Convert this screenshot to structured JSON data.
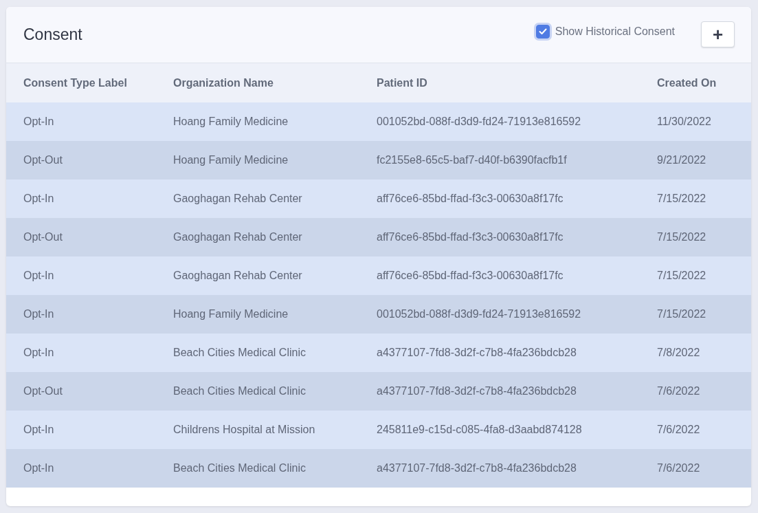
{
  "card": {
    "title": "Consent"
  },
  "show_historical": {
    "label": "Show Historical Consent",
    "checked": true
  },
  "add_button": {
    "label": "+"
  },
  "table": {
    "columns": [
      "Consent Type Label",
      "Organization Name",
      "Patient ID",
      "Created On"
    ],
    "rows": [
      [
        "Opt-In",
        "Hoang Family Medicine",
        "001052bd-088f-d3d9-fd24-71913e816592",
        "11/30/2022"
      ],
      [
        "Opt-Out",
        "Hoang Family Medicine",
        "fc2155e8-65c5-baf7-d40f-b6390facfb1f",
        "9/21/2022"
      ],
      [
        "Opt-In",
        "Gaoghagan Rehab Center",
        "aff76ce6-85bd-ffad-f3c3-00630a8f17fc",
        "7/15/2022"
      ],
      [
        "Opt-Out",
        "Gaoghagan Rehab Center",
        "aff76ce6-85bd-ffad-f3c3-00630a8f17fc",
        "7/15/2022"
      ],
      [
        "Opt-In",
        "Gaoghagan Rehab Center",
        "aff76ce6-85bd-ffad-f3c3-00630a8f17fc",
        "7/15/2022"
      ],
      [
        "Opt-In",
        "Hoang Family Medicine",
        "001052bd-088f-d3d9-fd24-71913e816592",
        "7/15/2022"
      ],
      [
        "Opt-In",
        "Beach Cities Medical Clinic",
        "a4377107-7fd8-3d2f-c7b8-4fa236bdcb28",
        "7/8/2022"
      ],
      [
        "Opt-Out",
        "Beach Cities Medical Clinic",
        "a4377107-7fd8-3d2f-c7b8-4fa236bdcb28",
        "7/6/2022"
      ],
      [
        "Opt-In",
        "Childrens Hospital at Mission",
        "245811e9-c15d-c085-4fa8-d3aabd874128",
        "7/6/2022"
      ],
      [
        "Opt-In",
        "Beach Cities Medical Clinic",
        "a4377107-7fd8-3d2f-c7b8-4fa236bdcb28",
        "7/6/2022"
      ]
    ]
  }
}
